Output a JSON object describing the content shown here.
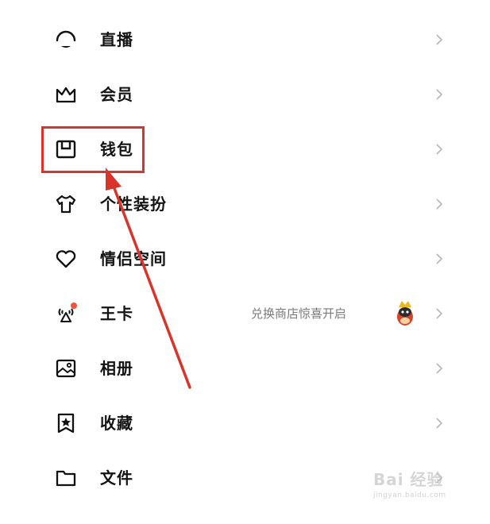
{
  "menu": {
    "items": [
      {
        "label": "直播",
        "icon": "live-icon"
      },
      {
        "label": "会员",
        "icon": "crown-icon"
      },
      {
        "label": "钱包",
        "icon": "wallet-icon"
      },
      {
        "label": "个性装扮",
        "icon": "tshirt-icon"
      },
      {
        "label": "情侣空间",
        "icon": "heart-icon"
      },
      {
        "label": "王卡",
        "icon": "signal-tower-icon",
        "badge_color": "#f0553a",
        "hint": "兑换商店惊喜开启"
      },
      {
        "label": "相册",
        "icon": "photo-album-icon"
      },
      {
        "label": "收藏",
        "icon": "bookmark-star-icon"
      },
      {
        "label": "文件",
        "icon": "folder-icon"
      }
    ]
  },
  "annotation": {
    "highlight_color": "#d9342b",
    "highlighted_item": "钱包"
  },
  "watermark": {
    "main": "Bai 经验",
    "sub": "jingyan.baidu.com"
  }
}
